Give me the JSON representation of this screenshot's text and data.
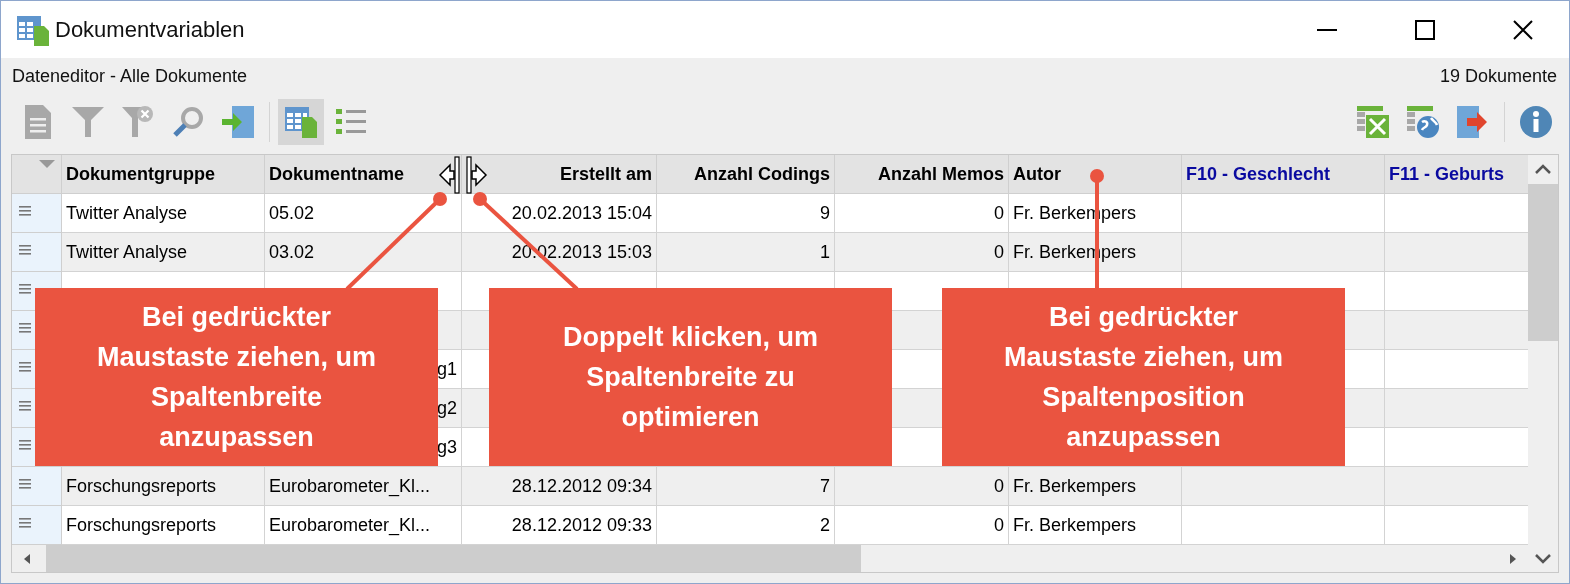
{
  "window": {
    "title": "Dokumentvariablen"
  },
  "info_bar": {
    "title": "Dateneditor - Alle Dokumente",
    "count": "19 Dokumente"
  },
  "view_buttons": [
    {
      "selected": true
    },
    {
      "selected": false
    }
  ],
  "table": {
    "columns": [
      {
        "label": "Dokumentgruppe",
        "kind": "text"
      },
      {
        "label": "Dokumentname",
        "kind": "text"
      },
      {
        "label": "Erstellt am",
        "kind": "number"
      },
      {
        "label": "Anzahl Codings",
        "kind": "number"
      },
      {
        "label": "Anzahl Memos",
        "kind": "number"
      },
      {
        "label": "Autor",
        "kind": "text"
      },
      {
        "label": "F10 - Geschlecht",
        "kind": "variable"
      },
      {
        "label": "F11 - Geburts",
        "kind": "variable"
      }
    ],
    "rows": [
      {
        "cells": [
          "Twitter Analyse",
          "05.02",
          "20.02.2013 15:04",
          "9",
          "0",
          "Fr. Berkempers"
        ]
      },
      {
        "cells": [
          "Twitter Analyse",
          "03.02",
          "20.02.2013 15:03",
          "1",
          "0",
          "Fr. Berkempers"
        ]
      },
      {
        "cells": []
      },
      {
        "cells": []
      },
      {
        "cells": [
          null,
          {
            "text": "g1",
            "cut": true
          }
        ]
      },
      {
        "cells": [
          null,
          {
            "text": "g2",
            "cut": true
          }
        ]
      },
      {
        "cells": [
          null,
          {
            "text": "g3",
            "cut": true
          }
        ]
      },
      {
        "cells": [
          "Forschungsreports",
          "Eurobarometer_Kl...",
          "28.12.2012 09:34",
          "7",
          "0",
          "Fr. Berkempers"
        ]
      },
      {
        "cells": [
          "Forschungsreports",
          "Eurobarometer_Kl...",
          "28.12.2012 09:33",
          "2",
          "0",
          "Fr. Berkempers"
        ]
      }
    ]
  },
  "callouts": [
    "Bei gedrückter Maustaste ziehen, um Spaltenbreite anzupassen",
    "Doppelt klicken, um Spaltenbreite zu optimieren",
    "Bei gedrückter Maustaste ziehen, um Spaltenposition anzupassen"
  ]
}
